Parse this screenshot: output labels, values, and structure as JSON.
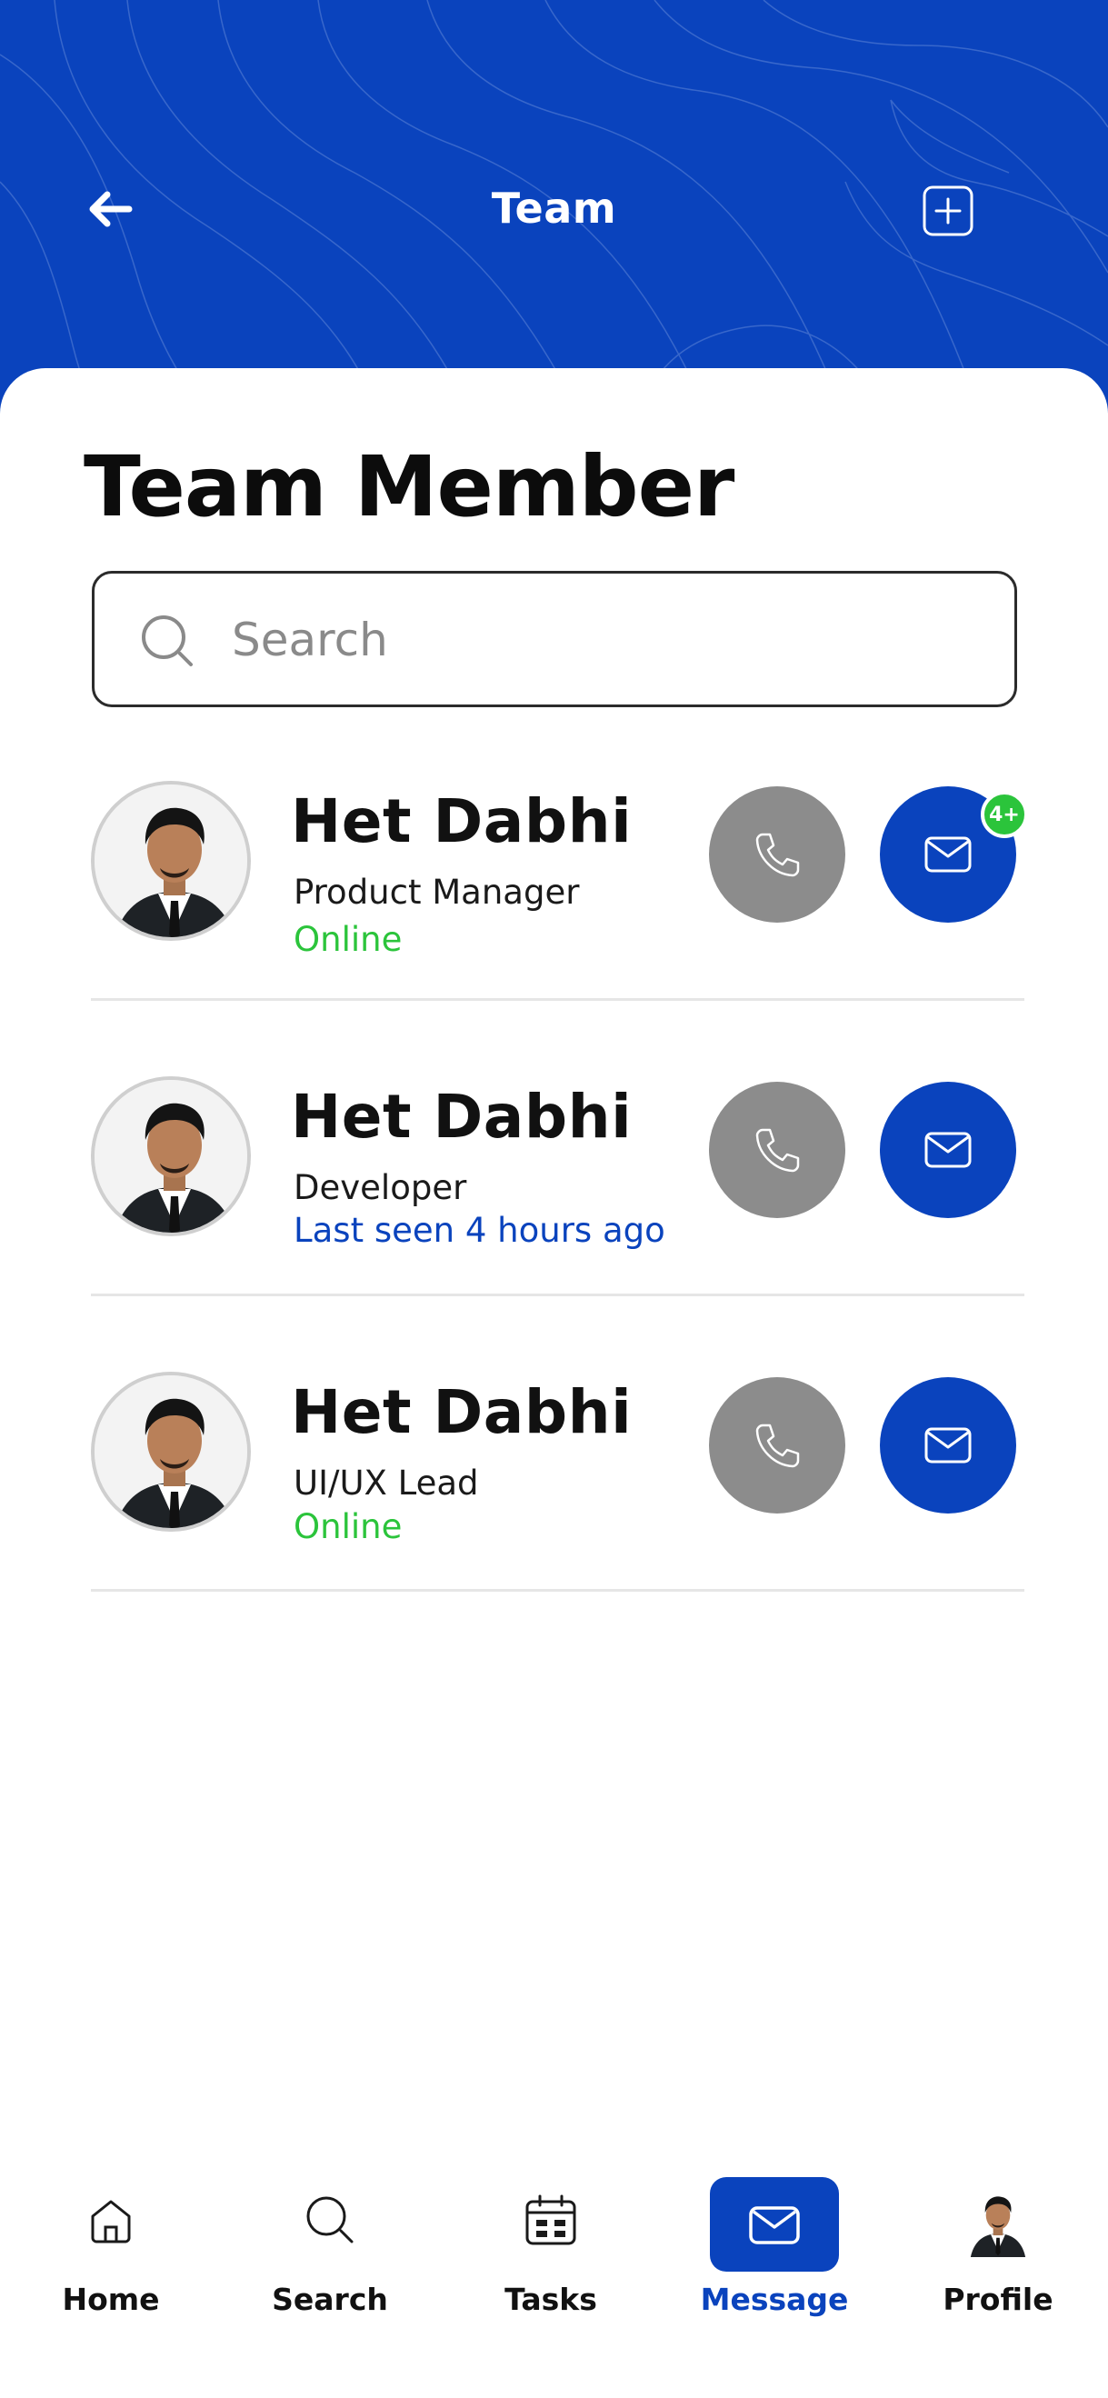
{
  "header": {
    "title": "Team",
    "back_icon": "arrow-left-icon",
    "add_icon": "plus-square-icon",
    "color": "#0a43bd"
  },
  "page": {
    "section_title": "Team Member"
  },
  "search": {
    "placeholder": "Search"
  },
  "members": [
    {
      "name": "Het Dabhi",
      "role": "Product Manager",
      "status": "Online",
      "status_type": "online",
      "unread_badge": "4+"
    },
    {
      "name": "Het Dabhi",
      "role": "Developer",
      "status": "Last seen 4 hours ago",
      "status_type": "away",
      "unread_badge": ""
    },
    {
      "name": "Het Dabhi",
      "role": "UI/UX Lead",
      "status": "Online",
      "status_type": "online",
      "unread_badge": ""
    }
  ],
  "nav": {
    "items": [
      {
        "label": "Home",
        "icon": "home-icon"
      },
      {
        "label": "Search",
        "icon": "search-icon"
      },
      {
        "label": "Tasks",
        "icon": "calendar-icon"
      },
      {
        "label": "Message",
        "icon": "mail-icon",
        "active": true
      },
      {
        "label": "Profile",
        "icon": "avatar"
      }
    ]
  },
  "colors": {
    "accent": "#0a43bd",
    "online": "#2bc43b",
    "call": "#8c8c8c"
  }
}
